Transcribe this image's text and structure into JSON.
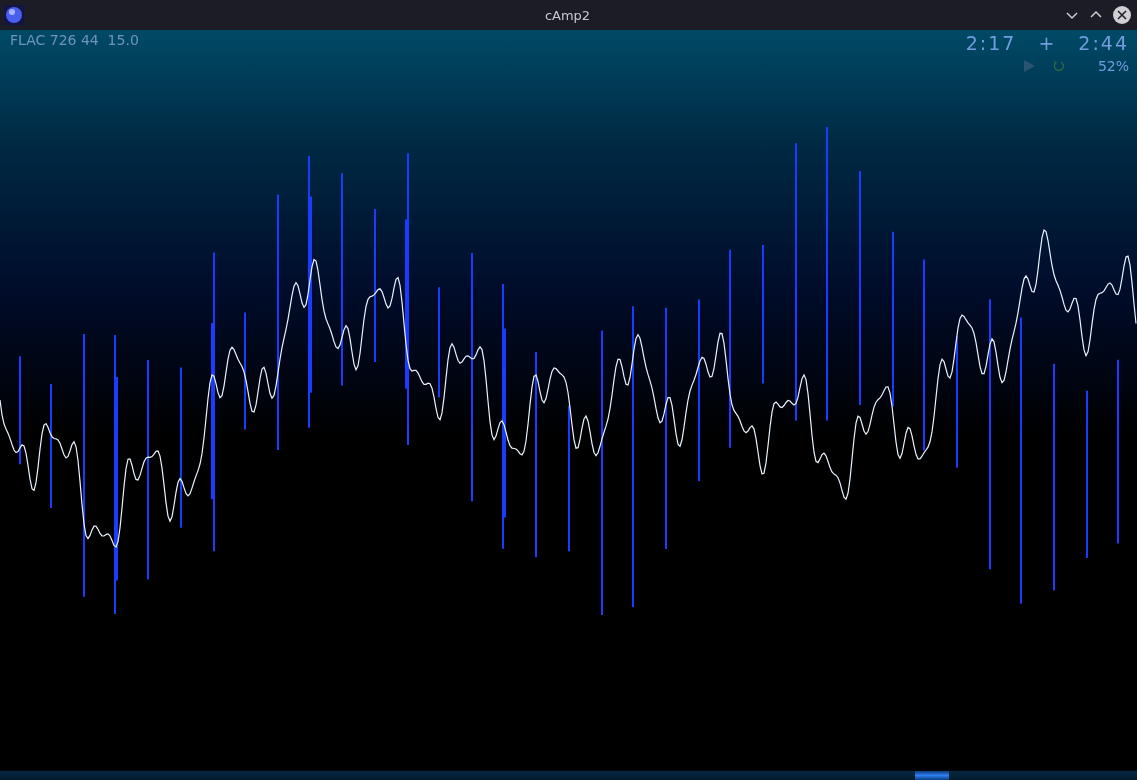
{
  "window": {
    "title": "cAmp2"
  },
  "info": {
    "format": "FLAC 726 44  15.0",
    "time_elapsed": "2:17",
    "separator": "+",
    "time_total": "2:44",
    "volume": "52%",
    "playing": false,
    "repeat": true
  },
  "seek": {
    "level": 0.82
  }
}
